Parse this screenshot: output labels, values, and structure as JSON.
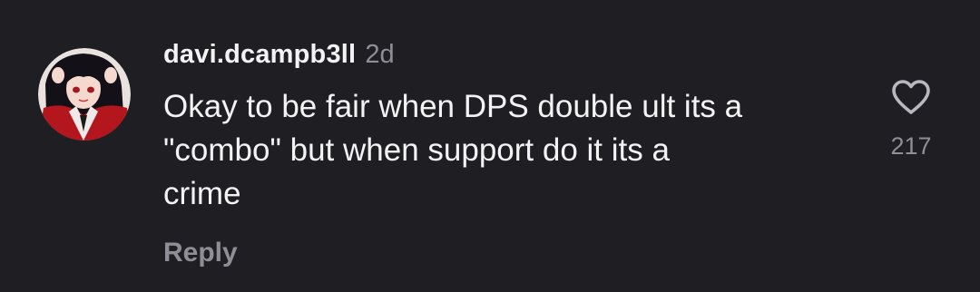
{
  "comment": {
    "username": "davi.dcampb3ll",
    "time": "2d",
    "text_lines": [
      "Okay to be fair when DPS double ult its a",
      "\"combo\" but when support do it its a",
      "crime"
    ],
    "reply_label": "Reply",
    "likes": "217",
    "avatar_icon": "anime-profile-avatar",
    "like_icon": "heart-outline-icon"
  }
}
